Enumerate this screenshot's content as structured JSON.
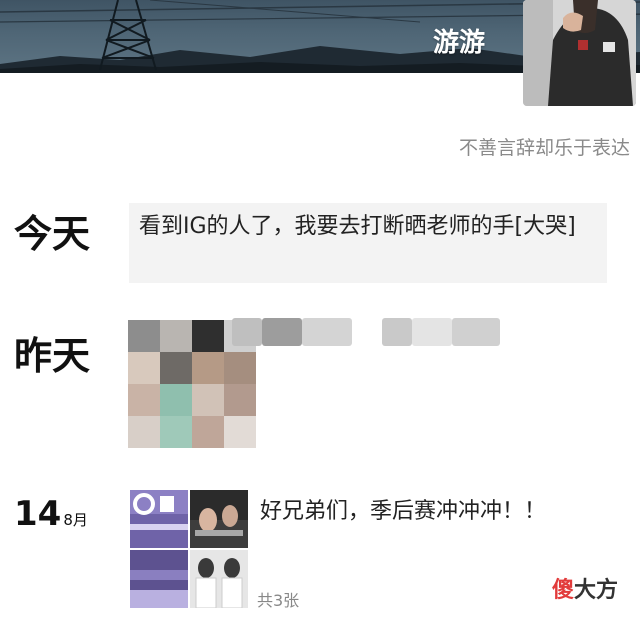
{
  "profile": {
    "nickname": "游游",
    "signature": "不善言辞却乐于表达"
  },
  "posts": [
    {
      "date_label": "今天",
      "text": "看到IG的人了，我要去打断晒老师的手[大哭]"
    },
    {
      "date_label": "昨天"
    },
    {
      "day": "14",
      "month": "8月",
      "text": "好兄弟们，季后赛冲冲冲！！",
      "photo_count": "共3张"
    }
  ],
  "watermark": {
    "part1": "傻",
    "part2": "大方"
  },
  "colors": {
    "cover": "#4f6676",
    "post_bg": "#f3f3f3",
    "signature": "#8a8a8a",
    "watermark_red": "#e23b3b"
  }
}
